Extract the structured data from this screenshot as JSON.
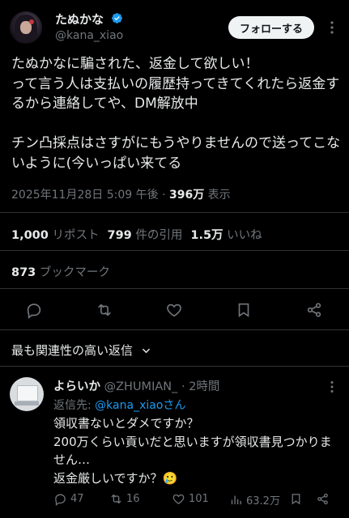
{
  "tweet": {
    "author_name": "たぬかな",
    "author_handle": "@kana_xiao",
    "follow_label": "フォローする",
    "text": "たぬかなに騙された、返金して欲しい！\nって言う人は支払いの履歴持ってきてくれたら返金するから連絡してや、DM解放中\n\nチン凸採点はさすがにもうやりませんので送ってこないように(今いっぱい来てる",
    "timestamp": "2025年11月28日 5:09 午後",
    "separator": "·",
    "views": "396万",
    "views_label": "表示",
    "stats": {
      "reposts": "1,000",
      "reposts_label": "リポスト",
      "quotes": "799",
      "quotes_label": "件の引用",
      "likes": "1.5万",
      "likes_label": "いいね",
      "bookmarks": "873",
      "bookmarks_label": "ブックマーク"
    },
    "colors": {
      "verified": "#1d9bf0",
      "accent": "#1d9bf0",
      "background": "#000000"
    }
  },
  "actions": [
    "reply-icon",
    "repost-icon",
    "like-icon",
    "bookmark-icon",
    "share-icon"
  ],
  "replies_sort": {
    "label": "最も関連性の高い返信",
    "icon": "chevron-down-icon"
  },
  "reply": {
    "author_name": "よらいか",
    "author_handle": "@ZHUMIAN_",
    "time": "· 2時間",
    "reply_to_label": "返信先:",
    "reply_to_handle": "@kana_xiaoさん",
    "text": "領収書ないとダメですか？\n200万くらい貢いだと思いますが領収書見つかりません…\n返金厳しいですか？🥲",
    "counts": {
      "replies": "47",
      "reposts": "16",
      "likes": "101",
      "views": "63.2万"
    }
  }
}
